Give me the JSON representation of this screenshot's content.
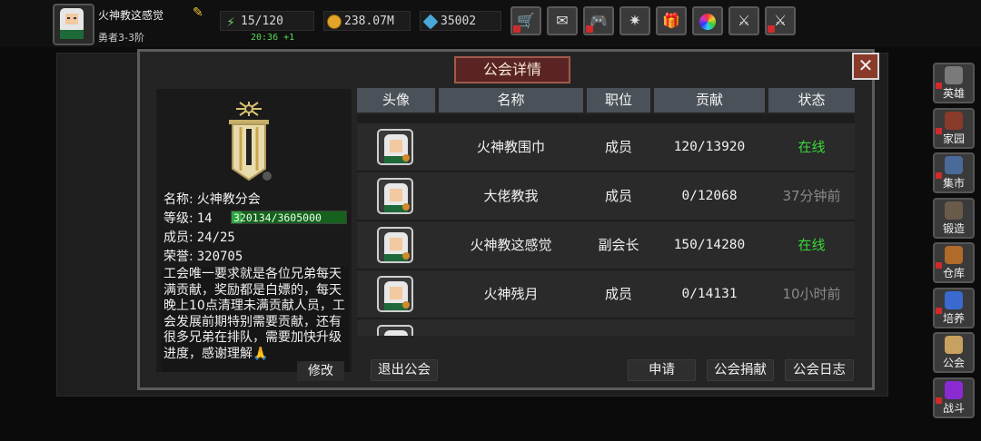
{
  "player": {
    "name": "火神教这感觉",
    "rank": "勇者3-3阶",
    "stamina": "15/120",
    "timer": "20:36 +1",
    "gold": "238.07M",
    "gems": "35002"
  },
  "toolbar": {
    "icons": [
      "shop-cart-icon",
      "mail-icon",
      "gamepad-icon",
      "gear-icon",
      "gift-icon",
      "color-wheel-icon",
      "sword-upgrade-icon",
      "crossed-swords-icon"
    ]
  },
  "dialog": {
    "title": "公会详情"
  },
  "guild": {
    "name_label": "名称:",
    "name": "火神教分会",
    "level_label": "等级:",
    "level": "14",
    "exp": "320134/3605000",
    "exp_fraction": 0.0888,
    "members_label": "成员:",
    "members": "24/25",
    "honor_label": "荣誉:",
    "honor": "320705",
    "description": "工会唯一要求就是各位兄弟每天满贡献，奖励都是白嫖的，每天晚上10点清理未满贡献人员，工会发展前期特别需要贡献，还有很多兄弟在排队，需要加快升级进度，感谢理解🙏",
    "modify_label": "修改"
  },
  "table": {
    "headers": [
      "头像",
      "名称",
      "职位",
      "贡献",
      "状态"
    ],
    "rows": [
      {
        "name": "火神教围巾",
        "role": "成员",
        "contribution": "120/13920",
        "status": "在线",
        "online": true
      },
      {
        "name": "大佬教我",
        "role": "成员",
        "contribution": "0/12068",
        "status": "37分钟前",
        "online": false
      },
      {
        "name": "火神教这感觉",
        "role": "副会长",
        "contribution": "150/14280",
        "status": "在线",
        "online": true
      },
      {
        "name": "火神残月",
        "role": "成员",
        "contribution": "0/14131",
        "status": "10小时前",
        "online": false
      }
    ]
  },
  "buttons": {
    "leave": "退出公会",
    "apply": "申请",
    "donate": "公会捐献",
    "log": "公会日志"
  },
  "sidebar": {
    "items": [
      {
        "label": "英雄",
        "icon": "hero-helmet-icon"
      },
      {
        "label": "家园",
        "icon": "home-gate-icon"
      },
      {
        "label": "集市",
        "icon": "market-stall-icon"
      },
      {
        "label": "锻造",
        "icon": "anvil-icon"
      },
      {
        "label": "仓库",
        "icon": "warehouse-icon"
      },
      {
        "label": "培养",
        "icon": "cultivate-icon"
      },
      {
        "label": "公会",
        "icon": "guild-icon"
      },
      {
        "label": "战斗",
        "icon": "battle-portal-icon"
      }
    ]
  }
}
